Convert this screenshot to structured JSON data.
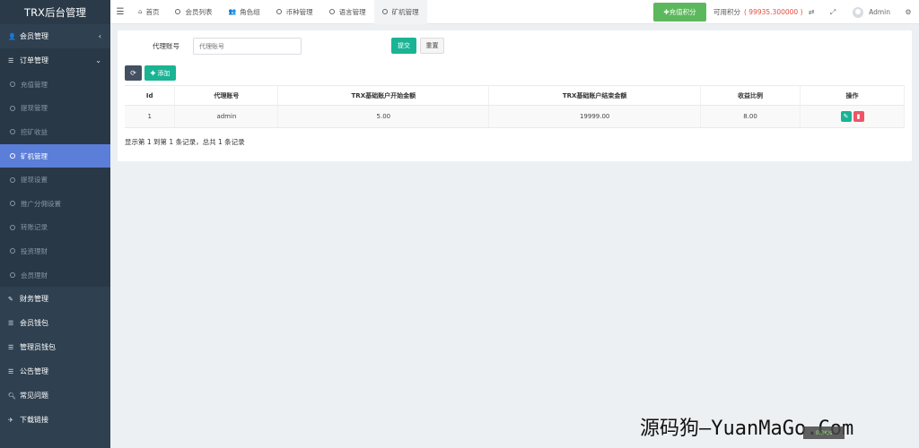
{
  "sidebar": {
    "title": "TRX后台管理",
    "top_items": [
      {
        "label": "会员管理",
        "arrow": "‹"
      },
      {
        "label": "订单管理",
        "arrow": "⌄"
      }
    ],
    "sub_items": [
      {
        "label": "充值管理"
      },
      {
        "label": "提现管理"
      },
      {
        "label": "挖矿收益"
      },
      {
        "label": "矿机管理"
      },
      {
        "label": "提现设置"
      },
      {
        "label": "推广分佣设置"
      },
      {
        "label": "转账记录"
      },
      {
        "label": "投资理财"
      },
      {
        "label": "会员理财"
      }
    ],
    "lower_items": [
      {
        "label": "财务管理"
      },
      {
        "label": "会员钱包"
      },
      {
        "label": "管理员钱包"
      },
      {
        "label": "公告管理"
      },
      {
        "label": "常见问题"
      },
      {
        "label": "下载链接"
      }
    ]
  },
  "topbar": {
    "tabs": [
      {
        "label": "首页"
      },
      {
        "label": "会员列表"
      },
      {
        "label": "角色组"
      },
      {
        "label": "币种管理"
      },
      {
        "label": "语言管理"
      },
      {
        "label": "矿机管理"
      }
    ],
    "recharge_label": "✚充值积分",
    "points_label": "可用积分",
    "points_value": "( 99935.300000 )",
    "admin_name": "Admin"
  },
  "search": {
    "label": "代理账号",
    "placeholder": "代理账号",
    "submit_label": "提交",
    "reset_label": "重置"
  },
  "toolbar": {
    "add_label": "✚ 添加"
  },
  "table": {
    "headers": [
      "Id",
      "代理账号",
      "TRX基础账户开始金额",
      "TRX基础账户结束金额",
      "收益比例",
      "操作"
    ],
    "rows": [
      [
        "1",
        "admin",
        "5.00",
        "19999.00",
        "8.00"
      ]
    ]
  },
  "pager_info": "显示第 1 到第 1 条记录，总共 1 条记录",
  "watermark": {
    "text": "源码狗—YuanMaGo.Com",
    "badge": "0.3K/s"
  }
}
